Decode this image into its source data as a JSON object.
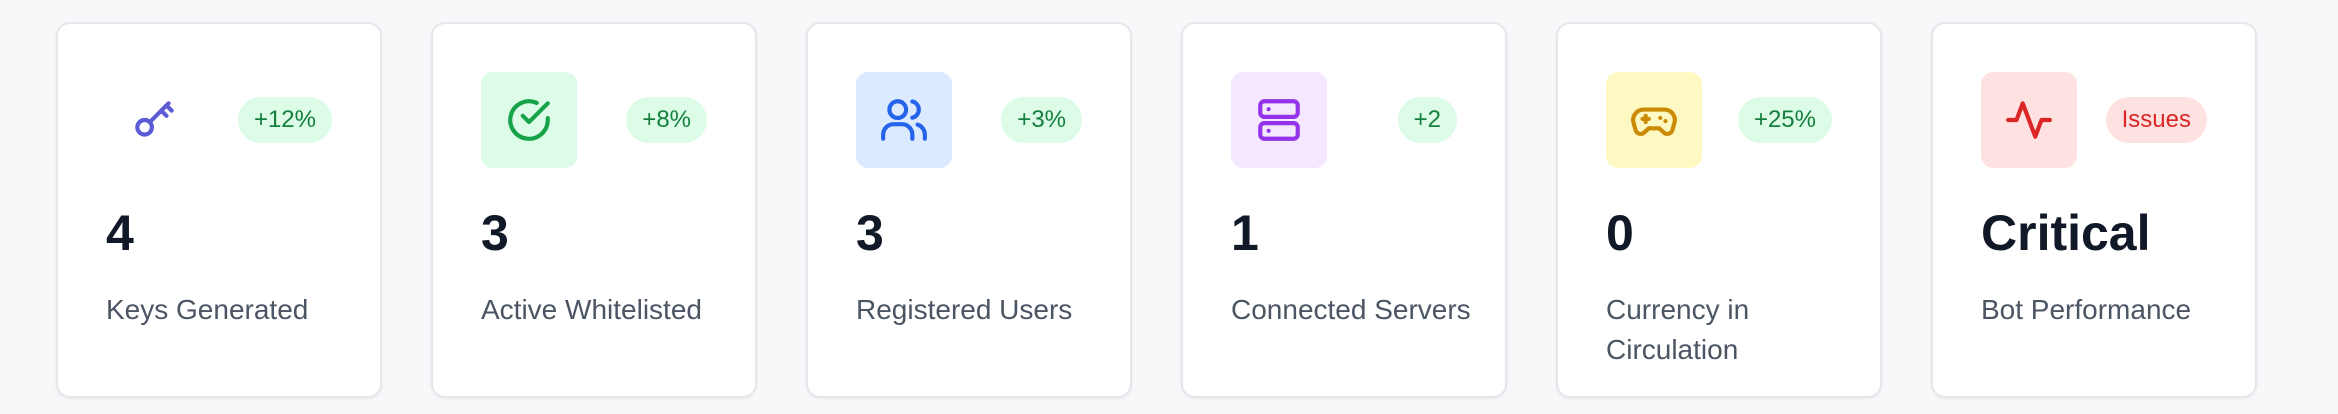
{
  "stats": [
    {
      "value": "4",
      "label": "Keys Generated",
      "badge": "+12%",
      "icon": "key-icon",
      "icon_bg": "#ffffff",
      "icon_color": "#5b5bd6"
    },
    {
      "value": "3",
      "label": "Active Whitelisted",
      "badge": "+8%",
      "icon": "check-circle-icon",
      "icon_bg": "#dcfce7",
      "icon_color": "#16a34a"
    },
    {
      "value": "3",
      "label": "Registered Users",
      "badge": "+3%",
      "icon": "users-icon",
      "icon_bg": "#dbeafe",
      "icon_color": "#2563eb"
    },
    {
      "value": "1",
      "label": "Connected Servers",
      "badge": "+2",
      "icon": "server-icon",
      "icon_bg": "#f3e8ff",
      "icon_color": "#9333ea"
    },
    {
      "value": "0",
      "label": "Currency in Circulation",
      "badge": "+25%",
      "icon": "gamepad-icon",
      "icon_bg": "#fef9c3",
      "icon_color": "#ca8a04"
    },
    {
      "value": "Critical",
      "label": "Bot Performance",
      "badge": "Issues",
      "icon": "activity-icon",
      "icon_bg": "#fee2e2",
      "icon_color": "#dc2626"
    }
  ],
  "colors": {
    "badge_positive_bg": "#dcfce7",
    "badge_positive_text": "#15803d",
    "badge_issue_bg": "#fee2e2",
    "badge_issue_text": "#dc2626"
  }
}
